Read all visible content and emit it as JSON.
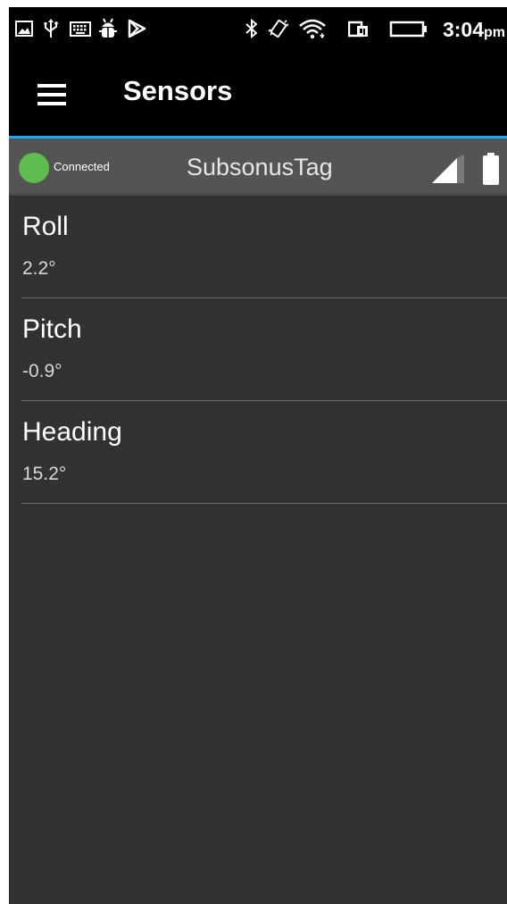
{
  "status_bar": {
    "icons": [
      "image-icon",
      "usb-icon",
      "keyboard-icon",
      "android-debug-icon",
      "play-store-icon",
      "bluetooth-icon",
      "vibrate-icon",
      "wifi-icon",
      "sim-icon",
      "battery-icon"
    ],
    "time": "3:04",
    "ampm": "pm"
  },
  "app_bar": {
    "title": "Sensors"
  },
  "device_bar": {
    "connection_status": "Connected",
    "device_name": "SubsonusTag",
    "status_color": "#5ebd4e"
  },
  "sensors": [
    {
      "name": "Roll",
      "value": "2.2°"
    },
    {
      "name": "Pitch",
      "value": "-0.9°"
    },
    {
      "name": "Heading",
      "value": "15.2°"
    }
  ],
  "colors": {
    "accent": "#3aa0d8",
    "background": "#323232",
    "device_bar": "#545454"
  }
}
